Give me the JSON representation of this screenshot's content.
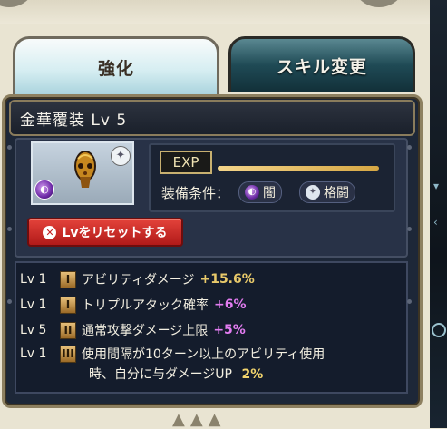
{
  "tabs": {
    "enhance_label": "強化",
    "skill_change_label": "スキル変更"
  },
  "weapon": {
    "title": "金華覆装 Lv 5",
    "element_icon": "dark-element-icon",
    "type_icon": "melee-type-icon"
  },
  "exp": {
    "label": "EXP",
    "progress": 1.0
  },
  "equip": {
    "label": "装備条件：",
    "element": "闇",
    "weapon_type": "格闘"
  },
  "reset_button": {
    "label": "Lvをリセットする"
  },
  "skills": [
    {
      "lv": "Lv 1",
      "rank": "I",
      "name": "アビリティダメージ",
      "value": "+15.6%"
    },
    {
      "lv": "Lv 1",
      "rank": "I",
      "name": "トリプルアタック確率",
      "value": "+6%"
    },
    {
      "lv": "Lv 5",
      "rank": "II",
      "name": "通常攻撃ダメージ上限",
      "value": "+5%"
    },
    {
      "lv": "Lv 1",
      "rank": "III",
      "name": "使用間隔が10ターン以上のアビリティ使用",
      "name2": "時、自分に与ダメージUP",
      "value": "2%"
    }
  ],
  "colors": {
    "accent_gold": "#e8c96a",
    "accent_purple": "#e27cf0",
    "reset_red": "#c62222"
  }
}
